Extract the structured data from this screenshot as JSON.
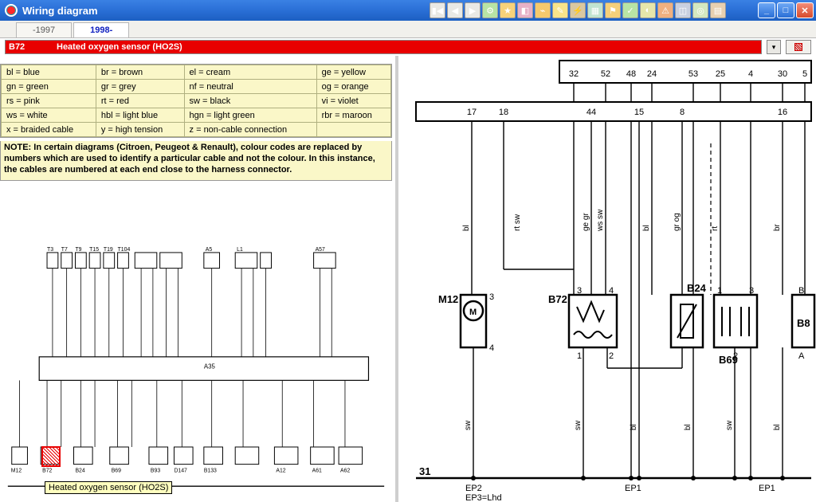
{
  "window": {
    "title": "Wiring diagram"
  },
  "tabs": [
    {
      "label": "-1997"
    },
    {
      "label": "1998-"
    }
  ],
  "descbar": {
    "code": "B72",
    "label": "Heated oxygen sensor (HO2S)"
  },
  "legend": {
    "rows": [
      [
        "bl = blue",
        "br = brown",
        "el = cream",
        "ge = yellow"
      ],
      [
        "gn = green",
        "gr = grey",
        "nf = neutral",
        "og = orange"
      ],
      [
        "rs = pink",
        "rt = red",
        "sw = black",
        "vi = violet"
      ],
      [
        "ws = white",
        "hbl = light blue",
        "hgn = light green",
        "rbr = maroon"
      ],
      [
        "x = braided cable",
        "y = high tension",
        "z = non-cable connection",
        ""
      ]
    ]
  },
  "note": "NOTE: In certain diagrams (Citroen, Peugeot & Renault), colour codes are replaced by numbers which are used to identify a particular cable and not the colour. In this instance, the cables are numbered at each end close to the harness connector.",
  "tooltip": "Heated oxygen sensor (HO2S)",
  "thumb": {
    "top_refs": [
      "T3",
      "T7",
      "T9",
      "T15",
      "T19",
      "T104",
      "A5",
      "L1",
      "A57"
    ],
    "bottom_labels": [
      "M12",
      "B72",
      "B24",
      "B69",
      "B93",
      "D147",
      "B133",
      "A12",
      "A61",
      "A62"
    ],
    "chip_label": "A35"
  },
  "schematic": {
    "top_connector_pins": [
      "32",
      "52",
      "48",
      "24",
      "53",
      "25",
      "4",
      "30",
      "5"
    ],
    "mid_connector_pins": [
      "17",
      "18",
      "44",
      "15",
      "8",
      "16"
    ],
    "wire_colors_upper": [
      "bl",
      "rt sw",
      "ge gr",
      "ws sw",
      "bl",
      "gr og",
      "rt",
      "br"
    ],
    "wire_colors_lower": [
      "sw",
      "sw",
      "bl",
      "bl",
      "sw",
      "bl"
    ],
    "ground_label": "31",
    "ground_points": [
      "EP2",
      "EP1",
      "EP1"
    ],
    "ground_note": "EP3=Lhd",
    "components": {
      "M12": {
        "name": "M12",
        "pins_top": [
          "3"
        ],
        "pins_bottom": [
          "4"
        ]
      },
      "B72": {
        "name": "B72",
        "pins_top": [
          "3",
          "4"
        ],
        "pins_bottom": [
          "1",
          "2"
        ]
      },
      "B24": {
        "name": "B24",
        "pins_top": [],
        "pins_bottom": []
      },
      "B69": {
        "name": "B69",
        "pins_top": [
          "1",
          "3"
        ],
        "pins_bottom": [
          "2"
        ]
      },
      "B8": {
        "name": "B8",
        "pins_top": [
          "B"
        ],
        "pins_bottom": [
          "A"
        ]
      }
    }
  }
}
